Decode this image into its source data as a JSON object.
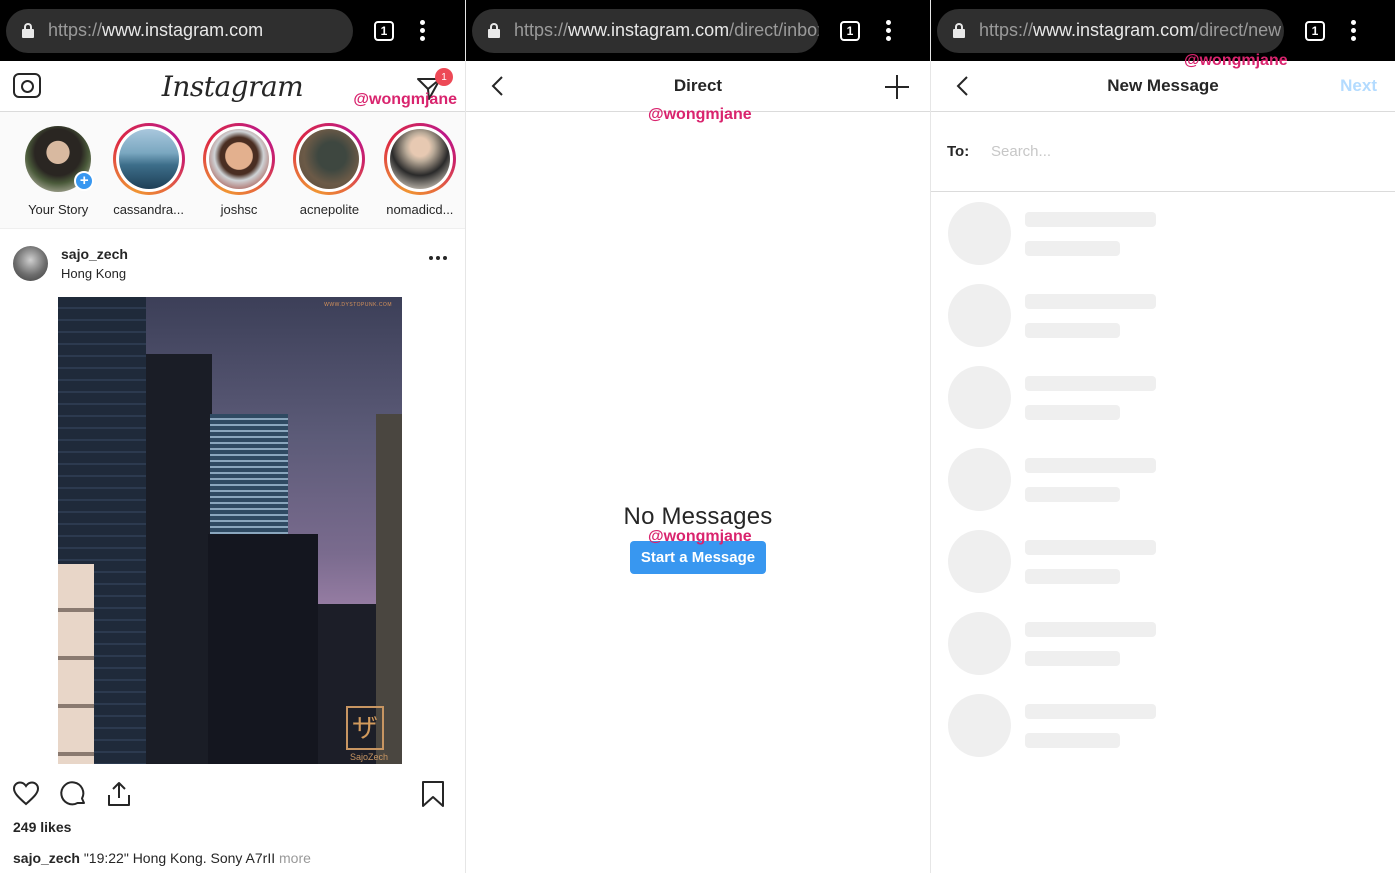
{
  "watermark": "@wongmjane",
  "colors": {
    "accent": "#3897f0",
    "watermark": "#d9246e",
    "badge": "#ed4956",
    "next_disabled": "#b3dbff",
    "skeleton": "#efefef"
  },
  "screens": [
    {
      "browser": {
        "url_scheme": "https://",
        "url_host": "www.instagram.com",
        "url_path": "",
        "tab_count": "1"
      },
      "header": {
        "logo": "Instagram",
        "camera_icon": "camera-icon",
        "direct_icon": "direct-paper-plane-icon",
        "direct_badge": "1"
      },
      "stories": [
        {
          "name": "Your Story",
          "own": true
        },
        {
          "name": "cassandra..."
        },
        {
          "name": "joshsc"
        },
        {
          "name": "acnepolite"
        },
        {
          "name": "nomadicd..."
        }
      ],
      "post": {
        "username": "sajo_zech",
        "location": "Hong Kong",
        "photo_credit": "WWW.DYSTOPUNK.COM",
        "photo_stamp": "ザ",
        "photo_stamp_label": "SajoZech",
        "likes": "249 likes",
        "caption_user": "sajo_zech",
        "caption_text": " \"19:22\" Hong Kong. Sony A7rII ",
        "caption_more": "more"
      }
    },
    {
      "browser": {
        "url_scheme": "https://",
        "url_host": "www.instagram.com",
        "url_path": "/direct/inbox",
        "tab_count": "1"
      },
      "header": {
        "title": "Direct"
      },
      "empty": {
        "title": "No Messages",
        "button": "Start a Message"
      }
    },
    {
      "browser": {
        "url_scheme": "https://",
        "url_host": "www.instagram.com",
        "url_path": "/direct/new",
        "tab_count": "1"
      },
      "header": {
        "title": "New Message",
        "next": "Next"
      },
      "to": {
        "label": "To:",
        "placeholder": "Search...",
        "value": ""
      },
      "skeleton_rows": 7
    }
  ]
}
